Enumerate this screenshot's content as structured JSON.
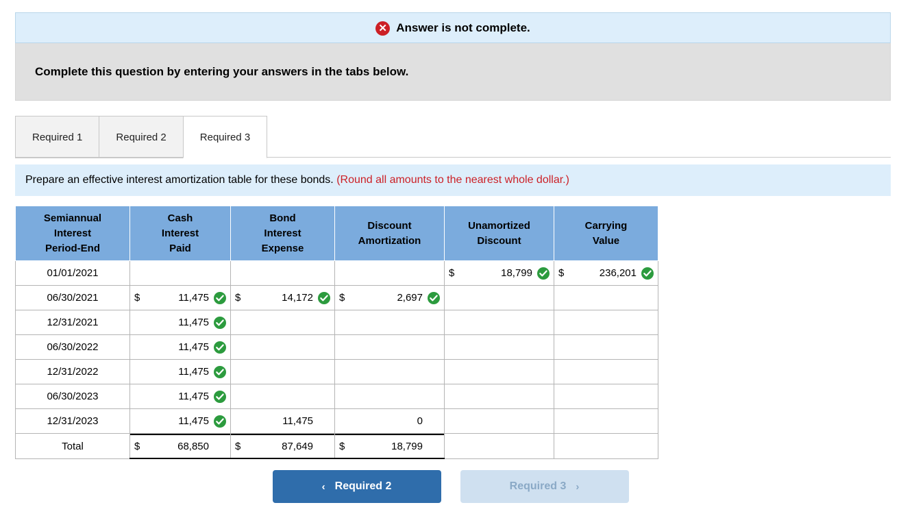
{
  "banner": {
    "icon": "error-circle-icon",
    "text": "Answer is not complete."
  },
  "instruction": {
    "text": "Complete this question by entering your answers in the tabs below."
  },
  "tabs": [
    {
      "label": "Required 1",
      "active": false
    },
    {
      "label": "Required 2",
      "active": false
    },
    {
      "label": "Required 3",
      "active": true
    }
  ],
  "question": {
    "text": "Prepare an effective interest amortization table for these bonds. ",
    "note": "(Round all amounts to the nearest whole dollar.)"
  },
  "table": {
    "headers": [
      "Semiannual\nInterest\nPeriod-End",
      "Cash\nInterest\nPaid",
      "Bond\nInterest\nExpense",
      "Discount\nAmortization",
      "Unamortized\nDiscount",
      "Carrying\nValue"
    ],
    "headers_lines": [
      [
        "Semiannual",
        "Interest",
        "Period-End"
      ],
      [
        "Cash",
        "Interest",
        "Paid"
      ],
      [
        "Bond",
        "Interest",
        "Expense"
      ],
      [
        "Discount",
        "Amortization"
      ],
      [
        "Unamortized",
        "Discount"
      ],
      [
        "Carrying",
        "Value"
      ]
    ],
    "rows": [
      {
        "period": "01/01/2021",
        "cash_interest_paid": {
          "dollar": "",
          "value": "",
          "check": false
        },
        "bond_interest_expense": {
          "dollar": "",
          "value": "",
          "check": false
        },
        "discount_amortization": {
          "dollar": "",
          "value": "",
          "check": false
        },
        "unamortized_discount": {
          "dollar": "$",
          "value": "18,799",
          "check": true
        },
        "carrying_value": {
          "dollar": "$",
          "value": "236,201",
          "check": true
        }
      },
      {
        "period": "06/30/2021",
        "cash_interest_paid": {
          "dollar": "$",
          "value": "11,475",
          "check": true
        },
        "bond_interest_expense": {
          "dollar": "$",
          "value": "14,172",
          "check": true
        },
        "discount_amortization": {
          "dollar": "$",
          "value": "2,697",
          "check": true
        },
        "unamortized_discount": {
          "dollar": "",
          "value": "",
          "check": false
        },
        "carrying_value": {
          "dollar": "",
          "value": "",
          "check": false
        }
      },
      {
        "period": "12/31/2021",
        "cash_interest_paid": {
          "dollar": "",
          "value": "11,475",
          "check": true
        },
        "bond_interest_expense": {
          "dollar": "",
          "value": "",
          "check": false
        },
        "discount_amortization": {
          "dollar": "",
          "value": "",
          "check": false
        },
        "unamortized_discount": {
          "dollar": "",
          "value": "",
          "check": false
        },
        "carrying_value": {
          "dollar": "",
          "value": "",
          "check": false
        }
      },
      {
        "period": "06/30/2022",
        "cash_interest_paid": {
          "dollar": "",
          "value": "11,475",
          "check": true
        },
        "bond_interest_expense": {
          "dollar": "",
          "value": "",
          "check": false
        },
        "discount_amortization": {
          "dollar": "",
          "value": "",
          "check": false
        },
        "unamortized_discount": {
          "dollar": "",
          "value": "",
          "check": false
        },
        "carrying_value": {
          "dollar": "",
          "value": "",
          "check": false
        }
      },
      {
        "period": "12/31/2022",
        "cash_interest_paid": {
          "dollar": "",
          "value": "11,475",
          "check": true
        },
        "bond_interest_expense": {
          "dollar": "",
          "value": "",
          "check": false
        },
        "discount_amortization": {
          "dollar": "",
          "value": "",
          "check": false
        },
        "unamortized_discount": {
          "dollar": "",
          "value": "",
          "check": false
        },
        "carrying_value": {
          "dollar": "",
          "value": "",
          "check": false
        }
      },
      {
        "period": "06/30/2023",
        "cash_interest_paid": {
          "dollar": "",
          "value": "11,475",
          "check": true
        },
        "bond_interest_expense": {
          "dollar": "",
          "value": "",
          "check": false
        },
        "discount_amortization": {
          "dollar": "",
          "value": "",
          "check": false
        },
        "unamortized_discount": {
          "dollar": "",
          "value": "",
          "check": false
        },
        "carrying_value": {
          "dollar": "",
          "value": "",
          "check": false
        }
      },
      {
        "period": "12/31/2023",
        "cash_interest_paid": {
          "dollar": "",
          "value": "11,475",
          "check": true
        },
        "bond_interest_expense": {
          "dollar": "",
          "value": "11,475",
          "check": false
        },
        "discount_amortization": {
          "dollar": "",
          "value": "0",
          "check": false
        },
        "unamortized_discount": {
          "dollar": "",
          "value": "",
          "check": false
        },
        "carrying_value": {
          "dollar": "",
          "value": "",
          "check": false
        }
      },
      {
        "period": "Total",
        "cash_interest_paid": {
          "dollar": "$",
          "value": "68,850",
          "check": false
        },
        "bond_interest_expense": {
          "dollar": "$",
          "value": "87,649",
          "check": false
        },
        "discount_amortization": {
          "dollar": "$",
          "value": "18,799",
          "check": false
        },
        "unamortized_discount": {
          "dollar": "",
          "value": "",
          "check": false
        },
        "carrying_value": {
          "dollar": "",
          "value": "",
          "check": false
        }
      }
    ]
  },
  "nav": {
    "prev_label": "Required 2",
    "prev_arrow": "‹",
    "next_label": "Required 3",
    "next_arrow": "›"
  },
  "colors": {
    "header_blue": "#7babdd",
    "banner_blue": "#ddeefb",
    "error_red": "#cc2026",
    "check_green": "#2c9b3e",
    "primary_button": "#2f6dab",
    "disabled_button": "#cfe0f0"
  }
}
